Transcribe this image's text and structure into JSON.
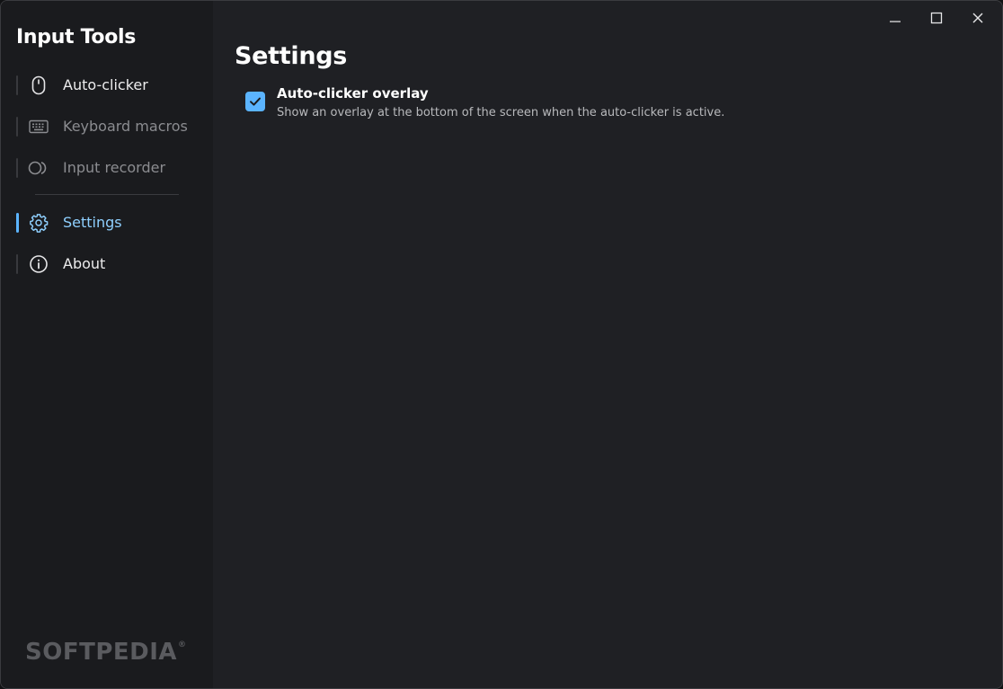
{
  "app": {
    "title": "Input Tools",
    "watermark": "SOFTPEDIA",
    "watermark_mark": "®"
  },
  "sidebar": {
    "items": [
      {
        "label": "Auto-clicker",
        "icon": "mouse-icon",
        "state": "normal"
      },
      {
        "label": "Keyboard macros",
        "icon": "keyboard-icon",
        "state": "disabled"
      },
      {
        "label": "Input recorder",
        "icon": "record-icon",
        "state": "disabled"
      },
      {
        "label": "Settings",
        "icon": "gear-icon",
        "state": "active"
      },
      {
        "label": "About",
        "icon": "info-icon",
        "state": "normal"
      }
    ]
  },
  "window_controls": {
    "icons": [
      "minimize-icon",
      "maximize-icon",
      "close-icon"
    ]
  },
  "main": {
    "page_title": "Settings",
    "settings": [
      {
        "title": "Auto-clicker overlay",
        "description": "Show an overlay at the bottom of the screen when the auto-clicker is active.",
        "checked": true
      }
    ]
  },
  "colors": {
    "accent": "#5bb4ff",
    "active_text": "#8fd0ff",
    "background": "#1f2024",
    "sidebar": "#1a1b1e",
    "disabled_text": "#8b8c90"
  }
}
